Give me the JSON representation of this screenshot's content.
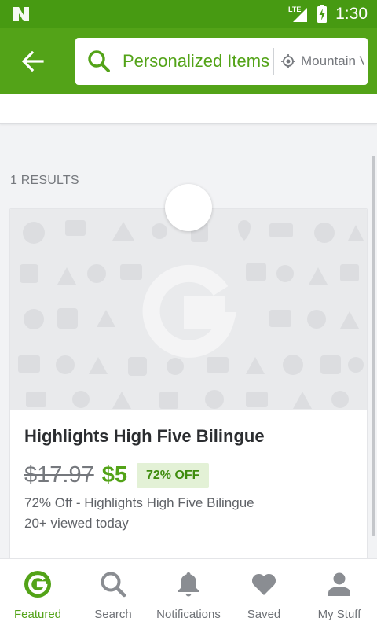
{
  "status_bar": {
    "time": "1:30",
    "network": "LTE"
  },
  "header": {
    "search_query": "Personalized Items",
    "location": "Mountain View"
  },
  "results": {
    "count_label": "1 RESULTS"
  },
  "deal": {
    "title": "Highlights High Five Bilingue",
    "original_price": "$17.97",
    "price": "$5",
    "discount": "72% OFF",
    "subtitle": "72% Off - Highlights High Five Bilingue",
    "views": "20+ viewed today"
  },
  "bottom_nav": {
    "items": [
      {
        "label": "Featured",
        "icon": "groupon-g-icon",
        "active": true
      },
      {
        "label": "Search",
        "icon": "search-icon",
        "active": false
      },
      {
        "label": "Notifications",
        "icon": "bell-icon",
        "active": false
      },
      {
        "label": "Saved",
        "icon": "heart-icon",
        "active": false
      },
      {
        "label": "My Stuff",
        "icon": "person-icon",
        "active": false
      }
    ]
  },
  "colors": {
    "brand_green": "#53a318",
    "status_bar_green": "#479a12",
    "text_dark": "#2b2d30",
    "text_muted": "#75787d"
  }
}
